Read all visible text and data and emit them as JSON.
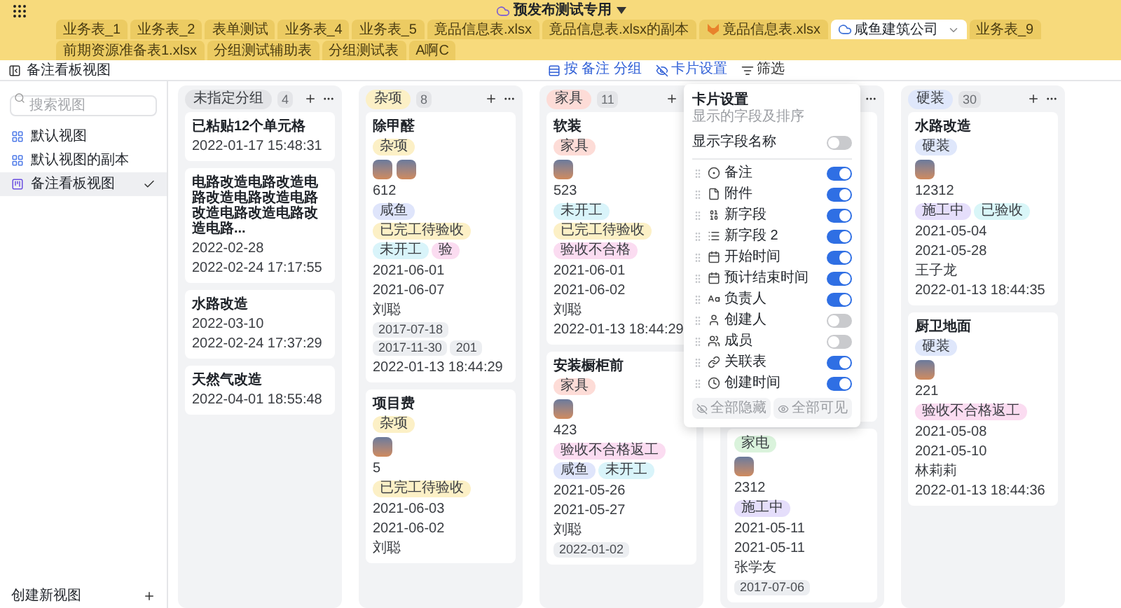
{
  "app": {
    "title": "预发布测试专用"
  },
  "tabs": [
    {
      "label": "业务表_1",
      "selected": false,
      "kind": "plain"
    },
    {
      "label": "业务表_2",
      "selected": false,
      "kind": "plain"
    },
    {
      "label": "表单测试",
      "selected": false,
      "kind": "plain"
    },
    {
      "label": "业务表_4",
      "selected": false,
      "kind": "plain"
    },
    {
      "label": "业务表_5",
      "selected": false,
      "kind": "plain"
    },
    {
      "label": "竟品信息表.xlsx",
      "selected": false,
      "kind": "plain"
    },
    {
      "label": "竟品信息表.xlsx的副本",
      "selected": false,
      "kind": "plain"
    },
    {
      "label": "竟品信息表.xlsx",
      "selected": false,
      "kind": "fox"
    },
    {
      "label": "咸鱼建筑公司",
      "selected": true,
      "kind": "cloud"
    },
    {
      "label": "业务表_9",
      "selected": false,
      "kind": "plain"
    },
    {
      "label": "前期资源准备表1.xlsx",
      "selected": false,
      "kind": "plain"
    },
    {
      "label": "分组测试辅助表",
      "selected": false,
      "kind": "plain"
    },
    {
      "label": "分组测试表",
      "selected": false,
      "kind": "plain"
    },
    {
      "label": "A啊C",
      "selected": false,
      "kind": "plain"
    }
  ],
  "toolbar": {
    "view_name": "备注看板视图",
    "buttons": [
      {
        "label": "按 备注 分组",
        "active": true,
        "kind": "group"
      },
      {
        "label": "卡片设置",
        "active": true,
        "kind": "card"
      },
      {
        "label": "筛选",
        "active": false,
        "kind": "filter"
      }
    ]
  },
  "sidebar": {
    "search_placeholder": "搜索视图",
    "views": [
      {
        "label": "默认视图",
        "selected": false,
        "kind": "grid"
      },
      {
        "label": "默认视图的副本",
        "selected": false,
        "kind": "grid"
      },
      {
        "label": "备注看板视图",
        "selected": true,
        "kind": "kanban"
      }
    ],
    "create": "创建新视图"
  },
  "columns": [
    {
      "label": "未指定分组",
      "color": "#e3e4e7",
      "count": "4",
      "cards": [
        {
          "fields": [
            {
              "kind": "title",
              "text": "已粘贴12个单元格"
            },
            {
              "kind": "text",
              "text": "2022-01-17 15:48:31"
            }
          ]
        },
        {
          "fields": [
            {
              "kind": "title",
              "text": "电路改造电路改造电路改造电路改造电路改造电路改造电路改造电路..."
            },
            {
              "kind": "text",
              "text": "2022-02-28"
            },
            {
              "kind": "text",
              "text": "2022-02-24 17:17:55"
            }
          ]
        },
        {
          "fields": [
            {
              "kind": "title",
              "text": "水路改造"
            },
            {
              "kind": "text",
              "text": "2022-03-10"
            },
            {
              "kind": "text",
              "text": "2022-02-24 17:37:29"
            }
          ]
        },
        {
          "fields": [
            {
              "kind": "title",
              "text": "天然气改造"
            },
            {
              "kind": "text",
              "text": "2022-04-01 18:55:48"
            }
          ]
        }
      ]
    },
    {
      "label": "杂项",
      "color": "#fcf0c6",
      "count": "8",
      "cards": [
        {
          "fields": [
            {
              "kind": "title",
              "text": "除甲醛"
            },
            {
              "kind": "tags",
              "tags": [
                {
                  "text": "杂项",
                  "color": "#fcf0c6"
                }
              ]
            },
            {
              "kind": "photos",
              "photos": [
                {
                  "kind": "photo"
                },
                {
                  "kind": "photo"
                }
              ]
            },
            {
              "kind": "text",
              "text": "612"
            },
            {
              "kind": "tags",
              "tags": [
                {
                  "text": "咸鱼",
                  "color": "#dfe5fb"
                },
                {
                  "text": "已完工待验收",
                  "color": "#fcf0c6"
                },
                {
                  "text": "未开工",
                  "color": "#d9f4fa"
                },
                {
                  "text": "验",
                  "color": "#fbdcf1"
                }
              ]
            },
            {
              "kind": "text",
              "text": "2021-06-01"
            },
            {
              "kind": "text",
              "text": "2021-06-07"
            },
            {
              "kind": "text",
              "text": "刘聪"
            },
            {
              "kind": "dates",
              "tags": [
                "2017-07-18",
                "2017-11-30",
                "201"
              ]
            },
            {
              "kind": "text",
              "text": "2022-01-13 18:44:29"
            }
          ]
        },
        {
          "fields": [
            {
              "kind": "title",
              "text": "项目费"
            },
            {
              "kind": "tags",
              "tags": [
                {
                  "text": "杂项",
                  "color": "#fcf0c6"
                }
              ]
            },
            {
              "kind": "photos",
              "photos": [
                {
                  "kind": "photo"
                }
              ]
            },
            {
              "kind": "text",
              "text": "5"
            },
            {
              "kind": "tags",
              "tags": [
                {
                  "text": "已完工待验收",
                  "color": "#fcf0c6"
                }
              ]
            },
            {
              "kind": "text",
              "text": "2021-06-03"
            },
            {
              "kind": "text",
              "text": "2021-06-02"
            },
            {
              "kind": "text",
              "text": "刘聪"
            }
          ]
        }
      ]
    },
    {
      "label": "家具",
      "color": "#fddcd7",
      "count": "11",
      "cards": [
        {
          "fields": [
            {
              "kind": "title",
              "text": "软装"
            },
            {
              "kind": "tags",
              "tags": [
                {
                  "text": "家具",
                  "color": "#fddcd7"
                }
              ]
            },
            {
              "kind": "photos",
              "photos": [
                {
                  "kind": "photo"
                }
              ]
            },
            {
              "kind": "text",
              "text": "523"
            },
            {
              "kind": "tags",
              "tags": [
                {
                  "text": "未开工",
                  "color": "#d9f4fa"
                },
                {
                  "text": "已完工待验收",
                  "color": "#fcf0c6"
                },
                {
                  "text": "验收不合格",
                  "color": "#fbdcf1"
                }
              ]
            },
            {
              "kind": "text",
              "text": "2021-06-01"
            },
            {
              "kind": "text",
              "text": "2021-06-02"
            },
            {
              "kind": "text",
              "text": "刘聪"
            },
            {
              "kind": "text",
              "text": "2022-01-13 18:44:29"
            }
          ]
        },
        {
          "fields": [
            {
              "kind": "title",
              "text": "安装橱柜前"
            },
            {
              "kind": "tags",
              "tags": [
                {
                  "text": "家具",
                  "color": "#fddcd7"
                }
              ]
            },
            {
              "kind": "photos",
              "photos": [
                {
                  "kind": "photo"
                }
              ]
            },
            {
              "kind": "text",
              "text": "423"
            },
            {
              "kind": "tags",
              "tags": [
                {
                  "text": "验收不合格返工",
                  "color": "#fbdcf1"
                },
                {
                  "text": "咸鱼",
                  "color": "#dfe5fb"
                },
                {
                  "text": "未开工",
                  "color": "#d9f4fa"
                }
              ]
            },
            {
              "kind": "text",
              "text": "2021-05-26"
            },
            {
              "kind": "text",
              "text": "2021-05-27"
            },
            {
              "kind": "text",
              "text": "刘聪"
            },
            {
              "kind": "dates",
              "tags": [
                "2022-01-02"
              ]
            }
          ]
        }
      ]
    },
    {
      "cards": [
        {
          "fields": [
            {
              "kind": "tags",
              "tags": [
                {
                  "text": "家电",
                  "color": "#daf3dc"
                }
              ]
            },
            {
              "kind": "photos",
              "photos": [
                {
                  "kind": "photo"
                }
              ]
            },
            {
              "kind": "text",
              "text": "2312"
            },
            {
              "kind": "tags",
              "tags": [
                {
                  "text": "施工中",
                  "color": "#e5defb"
                }
              ]
            },
            {
              "kind": "text",
              "text": "2021-05-11"
            },
            {
              "kind": "text",
              "text": "2021-05-11"
            },
            {
              "kind": "text",
              "text": "张学友"
            },
            {
              "kind": "dates",
              "tags": [
                "2017-07-06"
              ]
            }
          ]
        }
      ]
    },
    {
      "label": "硬装",
      "color": "#dfe7fb",
      "count": "30",
      "cards": [
        {
          "fields": [
            {
              "kind": "title",
              "text": "水路改造"
            },
            {
              "kind": "tags",
              "tags": [
                {
                  "text": "硬装",
                  "color": "#dfe7fb"
                }
              ]
            },
            {
              "kind": "photos",
              "photos": [
                {
                  "kind": "photo"
                }
              ]
            },
            {
              "kind": "text",
              "text": "12312"
            },
            {
              "kind": "tags",
              "tags": [
                {
                  "text": "施工中",
                  "color": "#e5defb"
                },
                {
                  "text": "已验收",
                  "color": "#d9f6f8"
                }
              ]
            },
            {
              "kind": "text",
              "text": "2021-05-04"
            },
            {
              "kind": "text",
              "text": "2021-05-28"
            },
            {
              "kind": "text",
              "text": "王子龙"
            },
            {
              "kind": "text",
              "text": "2022-01-13 18:44:35"
            }
          ]
        },
        {
          "fields": [
            {
              "kind": "title",
              "text": "厨卫地面"
            },
            {
              "kind": "tags",
              "tags": [
                {
                  "text": "硬装",
                  "color": "#dfe7fb"
                }
              ]
            },
            {
              "kind": "photos",
              "photos": [
                {
                  "kind": "photo"
                }
              ]
            },
            {
              "kind": "text",
              "text": "221"
            },
            {
              "kind": "tags",
              "tags": [
                {
                  "text": "验收不合格返工",
                  "color": "#fbdcf1"
                }
              ]
            },
            {
              "kind": "text",
              "text": "2021-05-08"
            },
            {
              "kind": "text",
              "text": "2021-05-10"
            },
            {
              "kind": "text",
              "text": "林莉莉"
            },
            {
              "kind": "text",
              "text": "2022-01-13 18:44:36"
            }
          ]
        }
      ]
    }
  ],
  "card_settings": {
    "title": "卡片设置",
    "subtitle": "显示的字段及排序",
    "show_names": {
      "label": "显示字段名称",
      "on": false
    },
    "fields": [
      {
        "label": "备注",
        "on": true
      },
      {
        "label": "附件",
        "on": true
      },
      {
        "label": "新字段",
        "on": true
      },
      {
        "label": "新字段 2",
        "on": true
      },
      {
        "label": "开始时间",
        "on": true
      },
      {
        "label": "预计结束时间",
        "on": true
      },
      {
        "label": "负责人",
        "on": true
      },
      {
        "label": "创建人",
        "on": false
      },
      {
        "label": "成员",
        "on": false
      },
      {
        "label": "关联表",
        "on": true
      },
      {
        "label": "创建时间",
        "on": true
      }
    ],
    "buttons": [
      {
        "label": "全部隐藏",
        "kind": "hide"
      },
      {
        "label": "全部可见",
        "kind": "show"
      }
    ]
  }
}
